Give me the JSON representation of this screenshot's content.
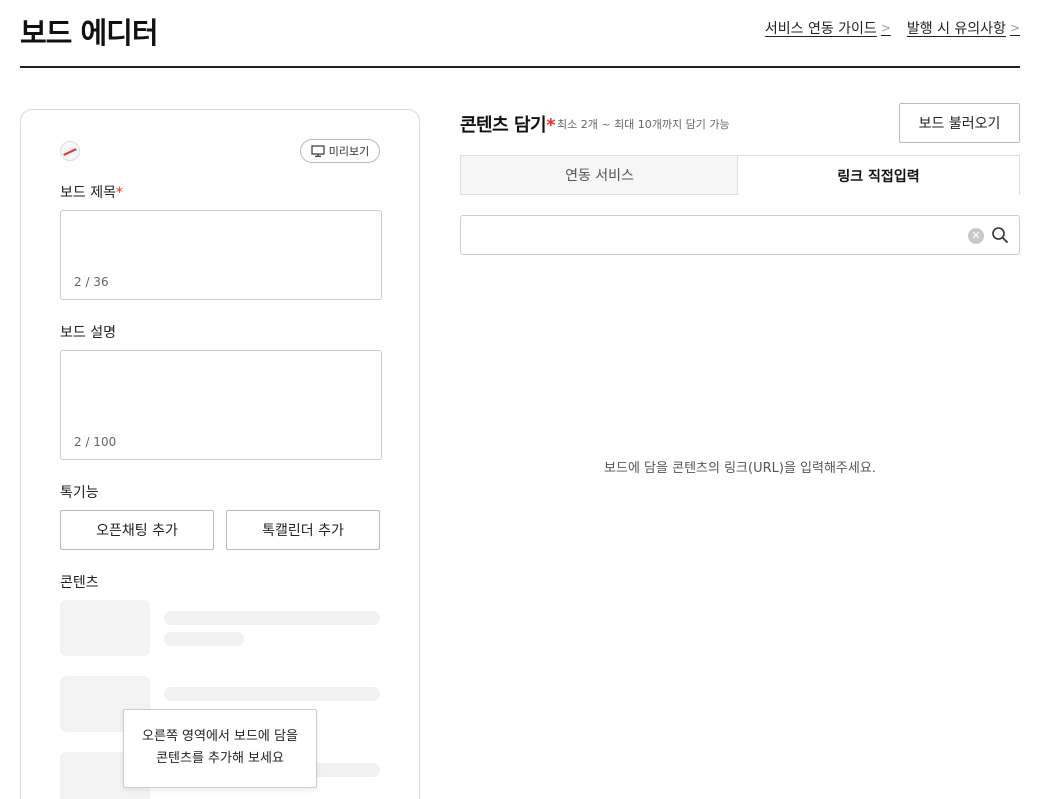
{
  "header": {
    "title": "보드 에디터",
    "links": [
      {
        "label": "서비스 연동 가이드"
      },
      {
        "label": "발행 시 유의사항"
      }
    ],
    "chevron": ">"
  },
  "left": {
    "preview_label": "미리보기",
    "title_label": "보드 제목",
    "required_mark": "*",
    "title_counter": "2 / 36",
    "desc_label": "보드 설명",
    "desc_counter": "2 / 100",
    "features_label": "톡기능",
    "features": [
      "오픈채팅 추가",
      "톡캘린더 추가"
    ],
    "content_label": "콘텐츠",
    "tooltip_line1": "오른쪽 영역에서 보드에 담을",
    "tooltip_line2": "콘텐츠를 추가해 보세요"
  },
  "right": {
    "title": "콘텐츠 담기",
    "required_mark": "*",
    "subtitle": "최소 2개 ~ 최대 10개까지 담기 가능",
    "load_button": "보드 불러오기",
    "tabs": [
      {
        "label": "연동 서비스",
        "active": false
      },
      {
        "label": "링크 직접입력",
        "active": true
      }
    ],
    "url_value": "",
    "empty_message": "보드에 담을 콘텐츠의 링크(URL)을 입력해주세요."
  },
  "icons": {
    "preview": "monitor-icon",
    "clear": "clear-icon",
    "search": "search-icon"
  },
  "colors": {
    "required": "#e4322b",
    "border": "#cccccc"
  }
}
